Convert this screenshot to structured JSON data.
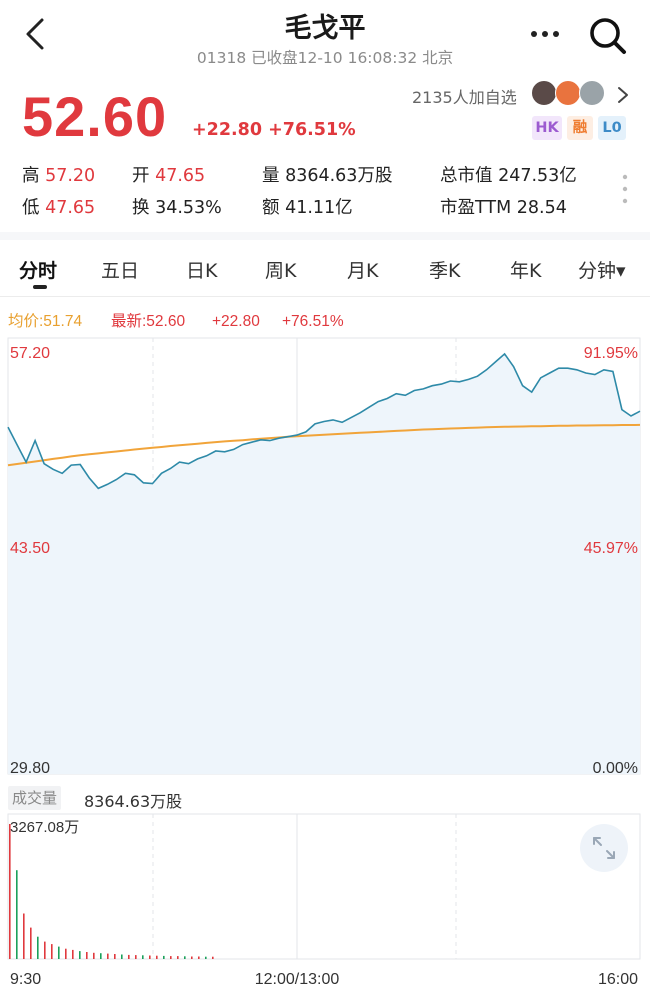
{
  "header": {
    "back_icon": "chevron-left-icon",
    "title": "毛戈平",
    "subtitle": "01318 已收盘12-10 16:08:32 北京",
    "more_icon": "more-horizontal-icon",
    "search_icon": "search-icon"
  },
  "quote": {
    "price": "52.60",
    "change": "+22.80 +76.51%",
    "followers": "2135人加自选",
    "badges": {
      "hk": "HK",
      "rong": "融",
      "lo": "L0"
    },
    "stats": {
      "high_label": "高",
      "high": "57.20",
      "open_label": "开",
      "open": "47.65",
      "volume_label": "量",
      "volume": "8364.63万股",
      "mcap_label": "总市值",
      "mcap": "247.53亿",
      "low_label": "低",
      "low": "47.65",
      "turnover_label": "换",
      "turnover": "34.53%",
      "amount_label": "额",
      "amount": "41.11亿",
      "pe_label": "市盈TTM",
      "pe": "28.54"
    }
  },
  "tabs": [
    "分时",
    "五日",
    "日K",
    "周K",
    "月K",
    "季K",
    "年K",
    "分钟▾"
  ],
  "active_tab": "分时",
  "legend": {
    "avg": "均价:51.74",
    "latest": "最新:52.60",
    "change": "+22.80",
    "pct": "+76.51%"
  },
  "colors": {
    "up": "#e0393e",
    "down": "#1ba05b",
    "price_line": "#2e8aa8",
    "avg_line": "#f1a43a",
    "fill": "#eef5fb",
    "grid": "#e3e6ea"
  },
  "chart_data": {
    "type": "line",
    "xlabels": [
      "9:30",
      "12:00/13:00",
      "16:00"
    ],
    "y_ticks_left": [
      "57.20",
      "43.50",
      "29.80"
    ],
    "y_ticks_right": [
      "91.95%",
      "45.97%",
      "0.00%"
    ],
    "ylim": [
      29.8,
      57.2
    ],
    "series": [
      {
        "name": "price",
        "values": [
          51.6,
          50.5,
          49.4,
          50.75,
          49.3,
          48.95,
          48.7,
          49.21,
          49.25,
          48.4,
          47.75,
          48.0,
          48.3,
          48.7,
          48.6,
          48.1,
          48.05,
          48.7,
          49.0,
          49.4,
          49.3,
          49.6,
          49.8,
          50.1,
          50.05,
          50.2,
          50.5,
          50.65,
          50.8,
          50.75,
          50.9,
          51.0,
          51.1,
          51.3,
          51.8,
          51.95,
          52.05,
          51.9,
          52.2,
          52.5,
          52.85,
          53.2,
          53.4,
          53.7,
          53.6,
          53.9,
          54.0,
          54.2,
          54.3,
          54.5,
          54.45,
          54.6,
          54.8,
          55.2,
          55.7,
          56.2,
          55.4,
          54.2,
          53.8,
          54.7,
          55.0,
          55.3,
          55.3,
          55.2,
          55.0,
          54.9,
          55.2,
          55.1,
          52.7,
          52.3,
          52.6
        ]
      },
      {
        "name": "avg",
        "values": [
          49.2,
          49.28,
          49.36,
          49.44,
          49.52,
          49.6,
          49.68,
          49.76,
          49.83,
          49.89,
          49.95,
          50.01,
          50.07,
          50.13,
          50.19,
          50.25,
          50.3,
          50.35,
          50.41,
          50.46,
          50.51,
          50.56,
          50.61,
          50.66,
          50.7,
          50.74,
          50.78,
          50.83,
          50.87,
          50.91,
          50.95,
          50.99,
          51.03,
          51.06,
          51.09,
          51.12,
          51.15,
          51.18,
          51.21,
          51.24,
          51.27,
          51.3,
          51.33,
          51.36,
          51.39,
          51.42,
          51.45,
          51.47,
          51.49,
          51.51,
          51.53,
          51.55,
          51.57,
          51.59,
          51.61,
          51.62,
          51.63,
          51.64,
          51.65,
          51.66,
          51.67,
          51.68,
          51.69,
          51.7,
          51.7,
          51.71,
          51.72,
          51.72,
          51.73,
          51.73,
          51.74
        ]
      }
    ],
    "volume": {
      "label": "成交量",
      "total": "8364.63万股",
      "max_label": "3267.08万",
      "max": 3267.08,
      "values": [
        3267.08,
        2150,
        1100,
        760,
        540,
        420,
        360,
        300,
        250,
        220,
        190,
        170,
        150,
        140,
        130,
        120,
        110,
        100,
        95,
        90,
        85,
        80,
        75,
        70,
        70,
        65,
        60,
        60,
        55,
        55
      ]
    }
  },
  "expand_icon": "expand-arrows-icon"
}
